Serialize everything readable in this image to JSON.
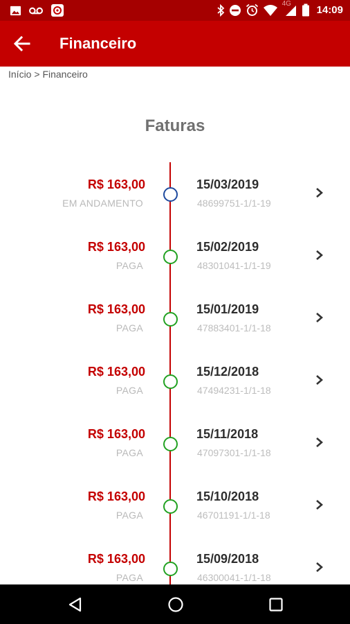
{
  "status_bar": {
    "time": "14:09",
    "network": "4G",
    "left_icons": [
      "image-icon",
      "voicemail-icon",
      "app-notification-icon"
    ],
    "right_icons": [
      "bluetooth-icon",
      "do-not-disturb-icon",
      "alarm-icon",
      "wifi-icon",
      "signal-icon",
      "battery-icon"
    ]
  },
  "app_bar": {
    "title": "Financeiro",
    "back_icon": "arrow-left-icon"
  },
  "breadcrumb": {
    "home": "Início",
    "separator": ">",
    "current": "Financeiro"
  },
  "page": {
    "title": "Faturas"
  },
  "invoices": [
    {
      "amount": "R$ 163,00",
      "status": "EM ANDAMENTO",
      "date": "15/03/2019",
      "code": "48699751-1/1-19"
    },
    {
      "amount": "R$ 163,00",
      "status": "PAGA",
      "date": "15/02/2019",
      "code": "48301041-1/1-19"
    },
    {
      "amount": "R$ 163,00",
      "status": "PAGA",
      "date": "15/01/2019",
      "code": "47883401-1/1-18"
    },
    {
      "amount": "R$ 163,00",
      "status": "PAGA",
      "date": "15/12/2018",
      "code": "47494231-1/1-18"
    },
    {
      "amount": "R$ 163,00",
      "status": "PAGA",
      "date": "15/11/2018",
      "code": "47097301-1/1-18"
    },
    {
      "amount": "R$ 163,00",
      "status": "PAGA",
      "date": "15/10/2018",
      "code": "46701191-1/1-18"
    },
    {
      "amount": "R$ 163,00",
      "status": "PAGA",
      "date": "15/09/2018",
      "code": "46300041-1/1-18"
    }
  ],
  "colors": {
    "status_bar": "#a50000",
    "app_bar": "#c40000",
    "amount": "#c40000",
    "timeline": "#c40000",
    "dot_paid": "#21a121",
    "dot_pending": "#1e4a9e"
  },
  "nav_bar": {
    "icons": [
      "back-triangle-icon",
      "home-circle-icon",
      "recents-square-icon"
    ]
  }
}
